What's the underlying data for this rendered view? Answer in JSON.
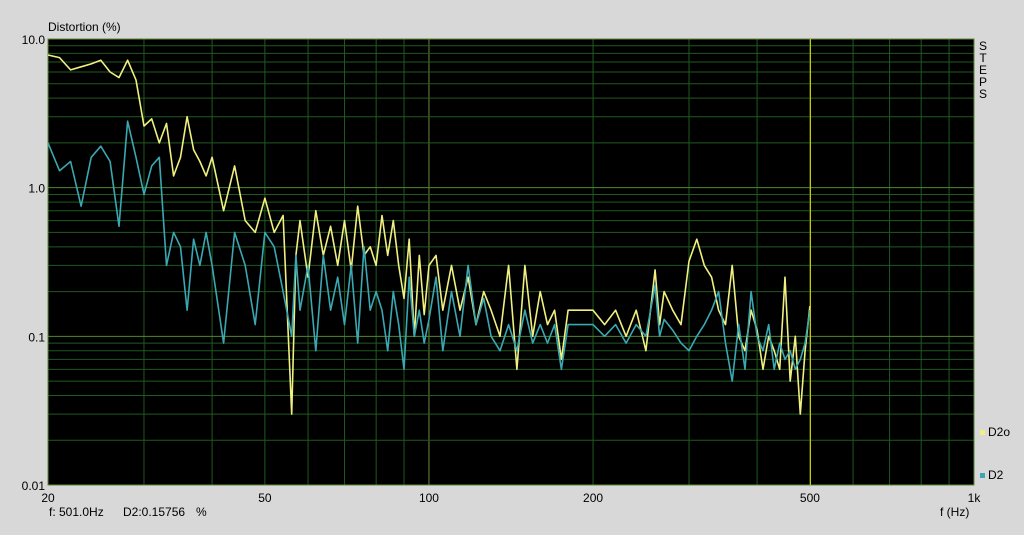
{
  "chart_data": {
    "type": "line",
    "title": "",
    "ylabel": "Distortion (%)",
    "xlabel": "f (Hz)",
    "side_label": "STEPS",
    "x_scale": "log",
    "y_scale": "log",
    "xlim": [
      20,
      1000
    ],
    "ylim": [
      0.01,
      10
    ],
    "x_ticks": [
      {
        "v": 20,
        "label": "20"
      },
      {
        "v": 50,
        "label": "50"
      },
      {
        "v": 100,
        "label": "100"
      },
      {
        "v": 200,
        "label": "200"
      },
      {
        "v": 500,
        "label": "500"
      },
      {
        "v": 1000,
        "label": "1k"
      }
    ],
    "y_ticks": [
      {
        "v": 10,
        "label": "10.0"
      },
      {
        "v": 1,
        "label": "1.0"
      },
      {
        "v": 0.1,
        "label": "0.1"
      },
      {
        "v": 0.01,
        "label": "0.01"
      }
    ],
    "grid": true,
    "cursor": {
      "x": 501.0,
      "readout_f": "f: 501.0Hz",
      "readout_val": "D2:0.15756",
      "readout_unit": "%"
    },
    "legend_position": "right",
    "series": [
      {
        "name": "D2o",
        "color": "#f0f080",
        "x": [
          20,
          21,
          22,
          23,
          24,
          25,
          26,
          27,
          28,
          29,
          30,
          31,
          32,
          33,
          34,
          35,
          36,
          37,
          38,
          39,
          40,
          42,
          44,
          46,
          48,
          50,
          52,
          54,
          56,
          57,
          58,
          60,
          62,
          64,
          66,
          68,
          70,
          72,
          74,
          76,
          78,
          80,
          82,
          84,
          86,
          88,
          90,
          92,
          94,
          96,
          98,
          100,
          103,
          106,
          110,
          114,
          118,
          122,
          126,
          130,
          135,
          140,
          145,
          150,
          155,
          160,
          165,
          170,
          175,
          180,
          190,
          200,
          210,
          220,
          230,
          240,
          250,
          260,
          265,
          270,
          280,
          290,
          300,
          310,
          320,
          330,
          340,
          350,
          360,
          370,
          380,
          390,
          400,
          410,
          420,
          430,
          440,
          450,
          460,
          470,
          480,
          490,
          500
        ],
        "y": [
          7.8,
          7.5,
          6.2,
          6.5,
          6.8,
          7.2,
          6.0,
          5.5,
          7.2,
          5.3,
          2.6,
          2.9,
          2.0,
          2.7,
          1.2,
          1.6,
          3.0,
          1.8,
          1.5,
          1.2,
          1.6,
          0.7,
          1.4,
          0.6,
          0.5,
          0.85,
          0.5,
          0.65,
          0.03,
          0.35,
          0.6,
          0.25,
          0.7,
          0.35,
          0.55,
          0.3,
          0.6,
          0.28,
          0.75,
          0.35,
          0.4,
          0.3,
          0.65,
          0.35,
          0.6,
          0.3,
          0.18,
          0.45,
          0.1,
          0.35,
          0.14,
          0.3,
          0.35,
          0.15,
          0.3,
          0.15,
          0.25,
          0.12,
          0.2,
          0.15,
          0.1,
          0.3,
          0.06,
          0.3,
          0.1,
          0.2,
          0.12,
          0.15,
          0.07,
          0.15,
          0.15,
          0.15,
          0.12,
          0.15,
          0.1,
          0.15,
          0.08,
          0.28,
          0.12,
          0.2,
          0.15,
          0.12,
          0.32,
          0.45,
          0.3,
          0.25,
          0.15,
          0.12,
          0.3,
          0.1,
          0.08,
          0.15,
          0.11,
          0.06,
          0.1,
          0.08,
          0.06,
          0.25,
          0.05,
          0.1,
          0.03,
          0.08,
          0.16
        ]
      },
      {
        "name": "D2",
        "color": "#3aa8b2",
        "x": [
          20,
          21,
          22,
          23,
          24,
          25,
          26,
          27,
          28,
          29,
          30,
          31,
          32,
          33,
          34,
          35,
          36,
          37,
          38,
          39,
          40,
          42,
          44,
          46,
          48,
          50,
          52,
          54,
          56,
          57,
          58,
          60,
          62,
          64,
          66,
          68,
          70,
          72,
          74,
          76,
          78,
          80,
          82,
          84,
          86,
          88,
          90,
          92,
          94,
          96,
          98,
          100,
          103,
          106,
          110,
          114,
          118,
          122,
          126,
          130,
          135,
          140,
          145,
          150,
          155,
          160,
          165,
          170,
          175,
          180,
          190,
          200,
          210,
          220,
          230,
          240,
          250,
          260,
          265,
          270,
          280,
          290,
          300,
          310,
          320,
          330,
          340,
          350,
          360,
          370,
          380,
          390,
          400,
          410,
          420,
          430,
          440,
          450,
          460,
          470,
          480,
          490,
          500
        ],
        "y": [
          2.0,
          1.3,
          1.5,
          0.75,
          1.6,
          1.9,
          1.5,
          0.55,
          2.8,
          1.6,
          0.9,
          1.4,
          1.6,
          0.3,
          0.5,
          0.4,
          0.15,
          0.45,
          0.3,
          0.5,
          0.3,
          0.09,
          0.5,
          0.3,
          0.12,
          0.5,
          0.4,
          0.2,
          0.1,
          0.35,
          0.15,
          0.3,
          0.08,
          0.35,
          0.15,
          0.25,
          0.12,
          0.3,
          0.09,
          0.4,
          0.15,
          0.2,
          0.15,
          0.08,
          0.2,
          0.12,
          0.06,
          0.25,
          0.1,
          0.15,
          0.09,
          0.13,
          0.25,
          0.08,
          0.2,
          0.1,
          0.3,
          0.12,
          0.18,
          0.1,
          0.08,
          0.12,
          0.08,
          0.15,
          0.09,
          0.12,
          0.09,
          0.12,
          0.06,
          0.12,
          0.12,
          0.12,
          0.1,
          0.12,
          0.09,
          0.12,
          0.1,
          0.22,
          0.1,
          0.13,
          0.11,
          0.09,
          0.08,
          0.1,
          0.12,
          0.15,
          0.2,
          0.09,
          0.05,
          0.12,
          0.06,
          0.2,
          0.1,
          0.08,
          0.12,
          0.06,
          0.09,
          0.07,
          0.08,
          0.06,
          0.07,
          0.09,
          0.15
        ]
      }
    ]
  }
}
